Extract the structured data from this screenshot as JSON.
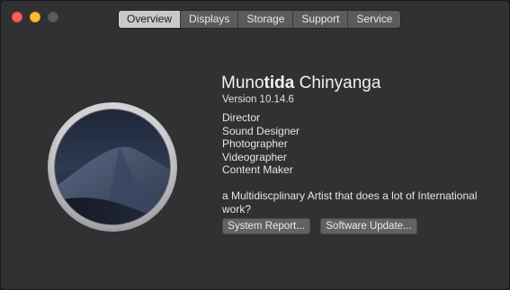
{
  "window": {
    "accent_close": "#fc5f57",
    "accent_minimize": "#fdbc2e",
    "accent_zoom": "#5d5d60"
  },
  "tabs": [
    {
      "label": "Overview",
      "active": true
    },
    {
      "label": "Displays",
      "active": false
    },
    {
      "label": "Storage",
      "active": false
    },
    {
      "label": "Support",
      "active": false
    },
    {
      "label": "Service",
      "active": false
    }
  ],
  "logo": {
    "icon": "macos-mojave-icon"
  },
  "profile": {
    "name_light": "Muno",
    "name_bold": "tida",
    "name_rest": " Chinyanga",
    "version": "Version 10.14.6",
    "roles": [
      "Director",
      "Sound Designer",
      "Photographer",
      "Videographer",
      "Content Maker"
    ],
    "bio": "a Multidiscplinary Artist that does a lot of International work?"
  },
  "buttons": {
    "system_report": "System Report...",
    "software_update": "Software Update..."
  }
}
